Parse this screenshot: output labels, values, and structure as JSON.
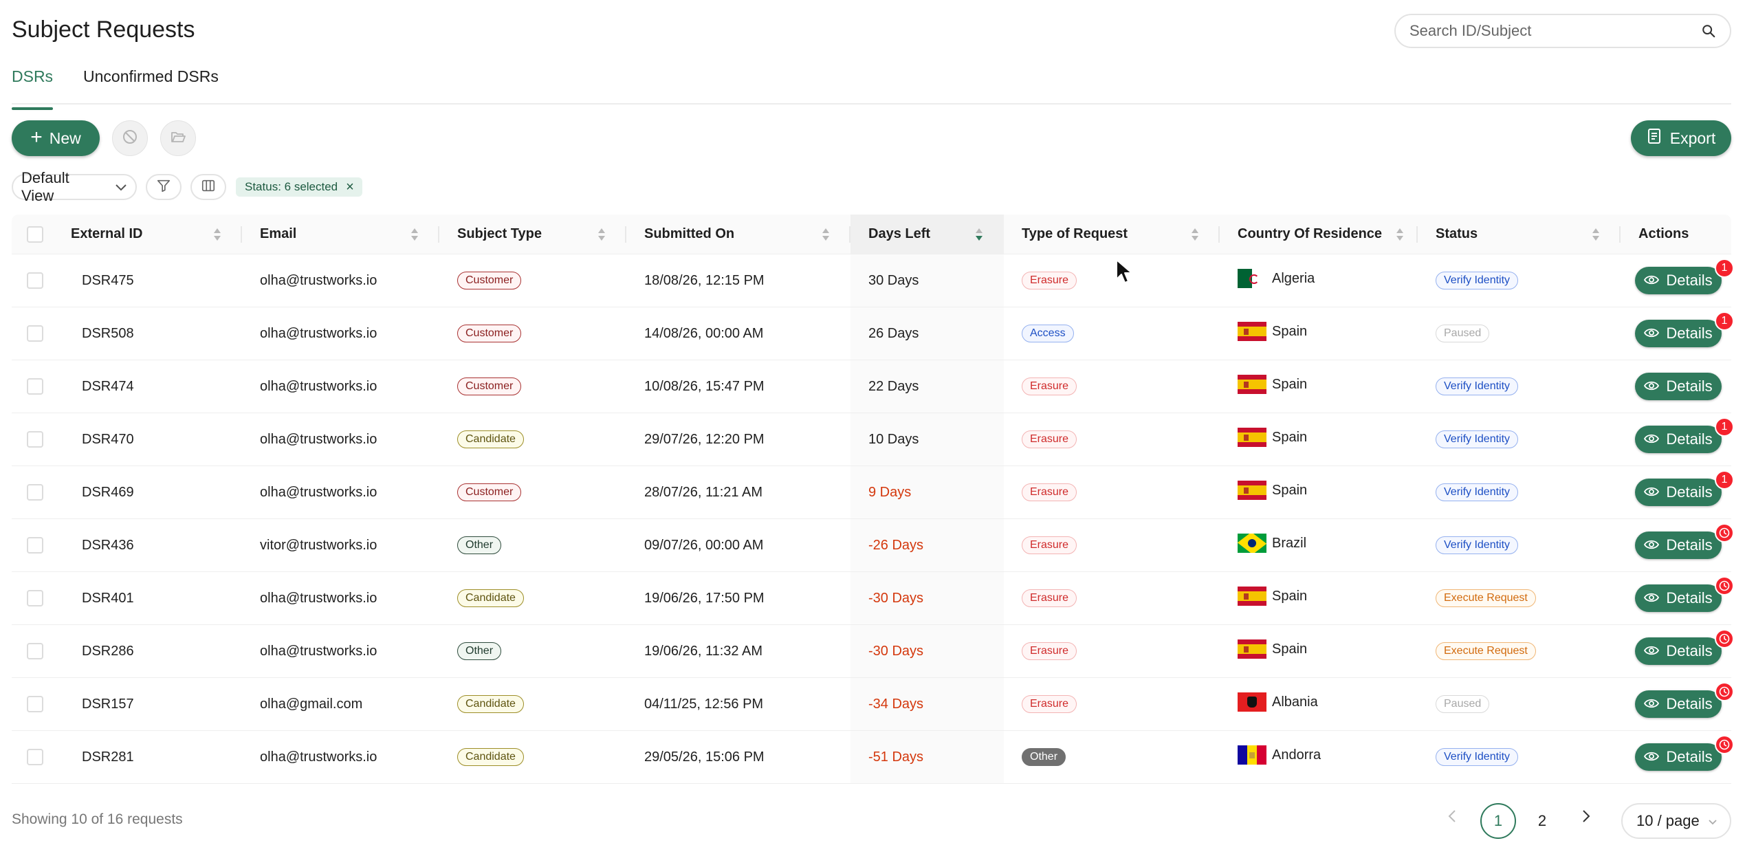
{
  "header": {
    "title": "Subject Requests",
    "search_placeholder": "Search ID/Subject"
  },
  "tabs": [
    {
      "label": "DSRs",
      "active": true
    },
    {
      "label": "Unconfirmed DSRs",
      "active": false
    }
  ],
  "toolbar": {
    "new_label": "New",
    "export_label": "Export",
    "view_label": "Default View",
    "filter_tag": "Status: 6 selected"
  },
  "table": {
    "columns": [
      "External ID",
      "Email",
      "Subject Type",
      "Submitted On",
      "Days Left",
      "Type of Request",
      "Country Of Residence",
      "Status",
      "Actions"
    ],
    "action_label": "Details",
    "rows": [
      {
        "id": "DSR475",
        "email": "olha@trustworks.io",
        "subject_type": "Customer",
        "submitted": "18/08/26, 12:15 PM",
        "days_left": "30 Days",
        "overdue": false,
        "request_type": "Erasure",
        "country": "Algeria",
        "flag": "dz",
        "status": "Verify Identity",
        "badge": "1"
      },
      {
        "id": "DSR508",
        "email": "olha@trustworks.io",
        "subject_type": "Customer",
        "submitted": "14/08/26, 00:00 AM",
        "days_left": "26 Days",
        "overdue": false,
        "request_type": "Access",
        "country": "Spain",
        "flag": "es",
        "status": "Paused",
        "badge": "1"
      },
      {
        "id": "DSR474",
        "email": "olha@trustworks.io",
        "subject_type": "Customer",
        "submitted": "10/08/26, 15:47 PM",
        "days_left": "22 Days",
        "overdue": false,
        "request_type": "Erasure",
        "country": "Spain",
        "flag": "es",
        "status": "Verify Identity",
        "badge": ""
      },
      {
        "id": "DSR470",
        "email": "olha@trustworks.io",
        "subject_type": "Candidate",
        "submitted": "29/07/26, 12:20 PM",
        "days_left": "10 Days",
        "overdue": false,
        "request_type": "Erasure",
        "country": "Spain",
        "flag": "es",
        "status": "Verify Identity",
        "badge": "1"
      },
      {
        "id": "DSR469",
        "email": "olha@trustworks.io",
        "subject_type": "Customer",
        "submitted": "28/07/26, 11:21 AM",
        "days_left": "9 Days",
        "overdue": true,
        "request_type": "Erasure",
        "country": "Spain",
        "flag": "es",
        "status": "Verify Identity",
        "badge": "1"
      },
      {
        "id": "DSR436",
        "email": "vitor@trustworks.io",
        "subject_type": "Other",
        "submitted": "09/07/26, 00:00 AM",
        "days_left": "-26 Days",
        "overdue": true,
        "request_type": "Erasure",
        "country": "Brazil",
        "flag": "br",
        "status": "Verify Identity",
        "badge": "clock"
      },
      {
        "id": "DSR401",
        "email": "olha@trustworks.io",
        "subject_type": "Candidate",
        "submitted": "19/06/26, 17:50 PM",
        "days_left": "-30 Days",
        "overdue": true,
        "request_type": "Erasure",
        "country": "Spain",
        "flag": "es",
        "status": "Execute Request",
        "badge": "clock"
      },
      {
        "id": "DSR286",
        "email": "olha@trustworks.io",
        "subject_type": "Other",
        "submitted": "19/06/26, 11:32 AM",
        "days_left": "-30 Days",
        "overdue": true,
        "request_type": "Erasure",
        "country": "Spain",
        "flag": "es",
        "status": "Execute Request",
        "badge": "clock"
      },
      {
        "id": "DSR157",
        "email": "olha@gmail.com",
        "subject_type": "Candidate",
        "submitted": "04/11/25, 12:56 PM",
        "days_left": "-34 Days",
        "overdue": true,
        "request_type": "Erasure",
        "country": "Albania",
        "flag": "al",
        "status": "Paused",
        "badge": "clock"
      },
      {
        "id": "DSR281",
        "email": "olha@trustworks.io",
        "subject_type": "Candidate",
        "submitted": "29/05/26, 15:06 PM",
        "days_left": "-51 Days",
        "overdue": true,
        "request_type": "Other",
        "country": "Andorra",
        "flag": "ad",
        "status": "Verify Identity",
        "badge": "clock"
      }
    ]
  },
  "footer": {
    "showing": "Showing 10 of 16 requests",
    "pages": [
      "1",
      "2"
    ],
    "current_page": "1",
    "page_size": "10 / page"
  },
  "colors": {
    "brand": "#2f7a5c",
    "overdue": "#d4380d",
    "badge": "#f5222d"
  }
}
